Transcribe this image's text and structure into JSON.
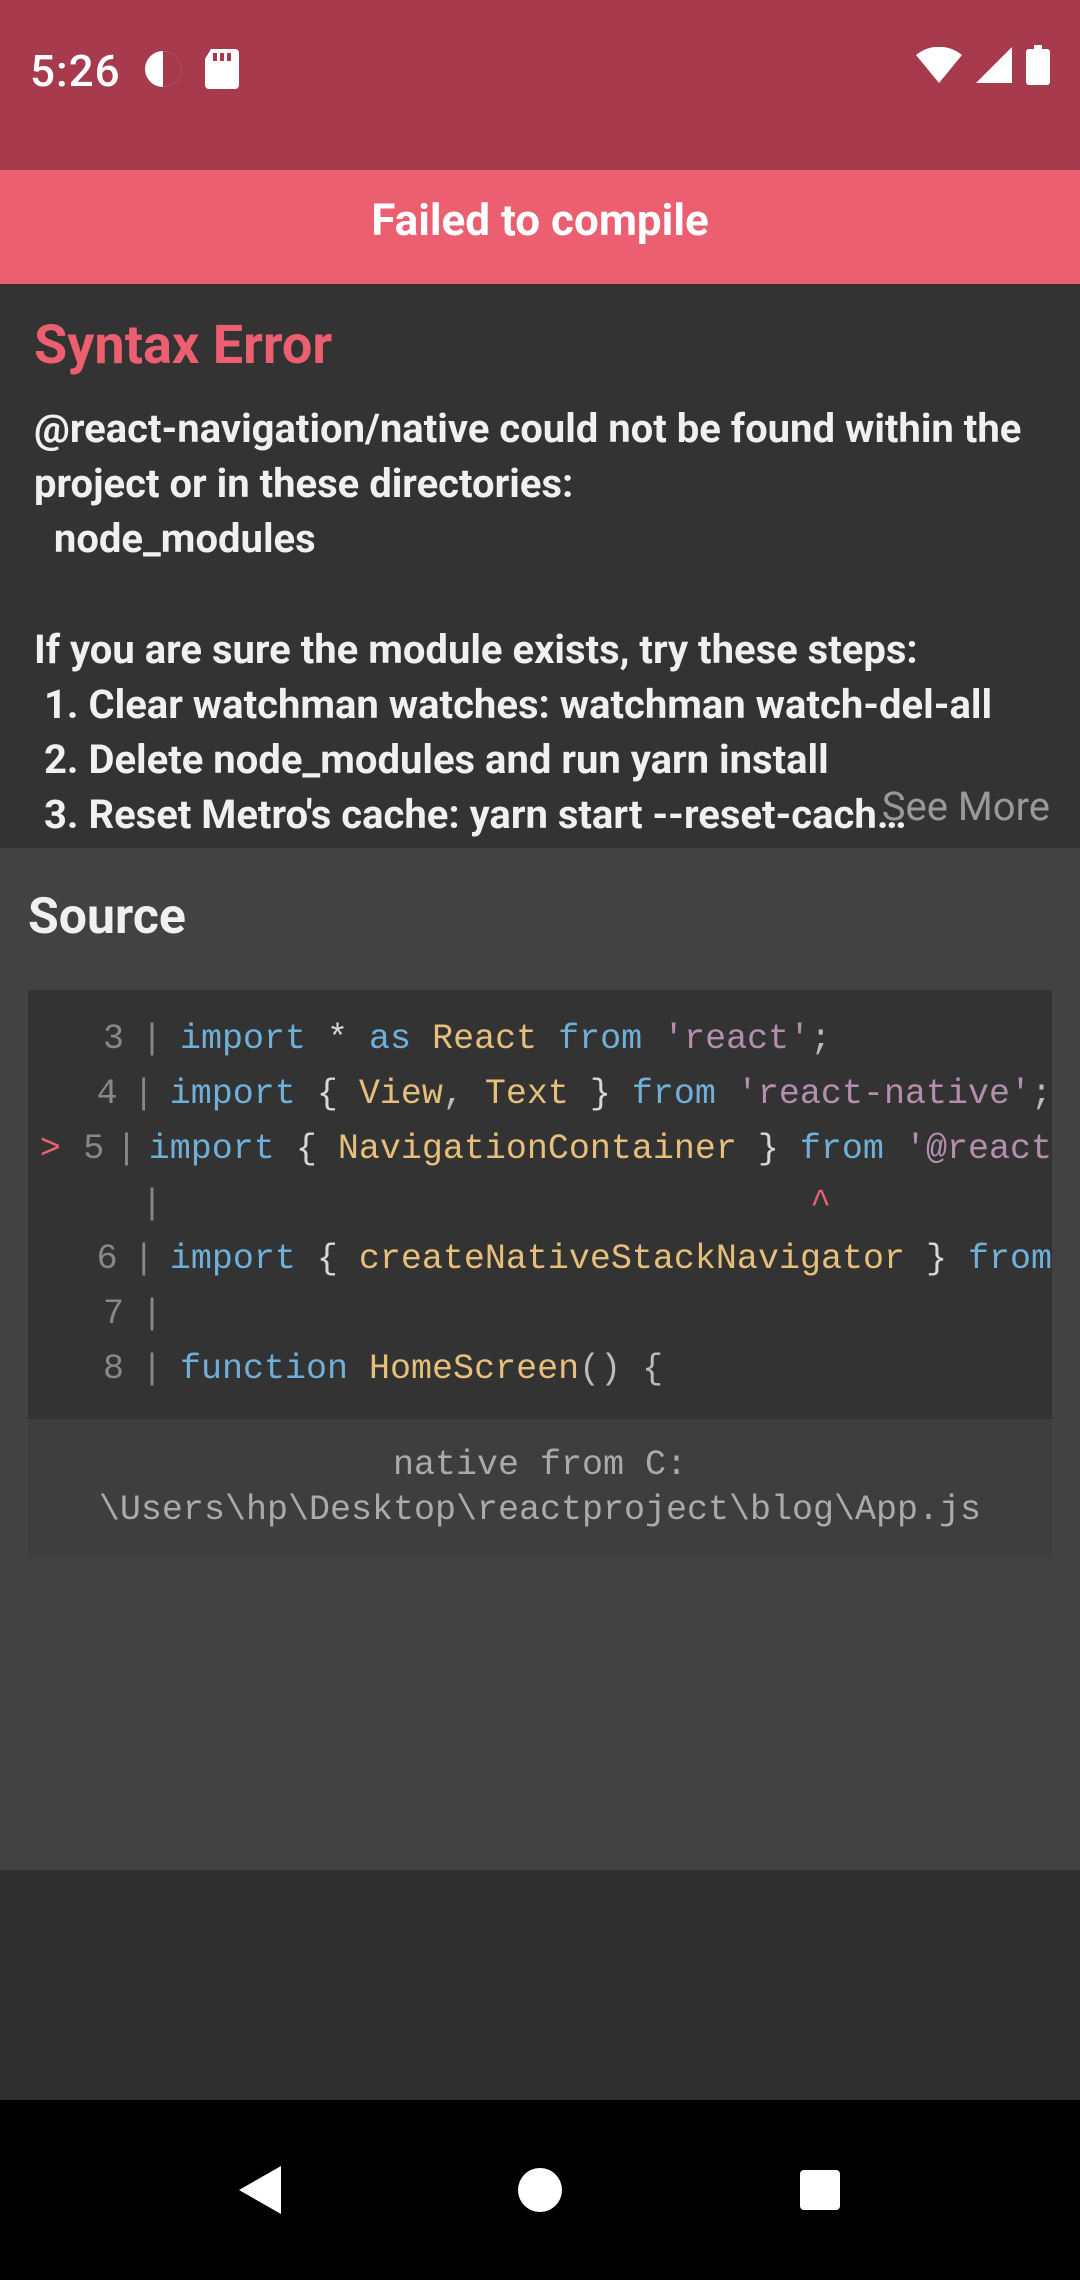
{
  "status": {
    "time": "5:26"
  },
  "banner": {
    "title": "Failed to compile"
  },
  "error": {
    "type": "Syntax Error",
    "message": "@react-navigation/native could not be found within the project or in these directories:\n  node_modules\n\nIf you are sure the module exists, try these steps:\n 1. Clear watchman watches: watchman watch-del-all\n 2. Delete node_modules and run yarn install\n 3. Reset Metro's cache: yarn start --reset-cach…",
    "see_more": "See More"
  },
  "source": {
    "title": "Source",
    "footer": "native from C:\n\\Users\\hp\\Desktop\\reactproject\\blog\\App.js",
    "lines": [
      {
        "n": 3,
        "mark": "",
        "tokens": [
          [
            "kw",
            "import"
          ],
          [
            "op",
            " * "
          ],
          [
            "kw",
            "as"
          ],
          [
            "op",
            " "
          ],
          [
            "id",
            "React"
          ],
          [
            "op",
            " "
          ],
          [
            "kw",
            "from"
          ],
          [
            "op",
            " "
          ],
          [
            "str",
            "'react'"
          ],
          [
            "punc",
            ";"
          ]
        ]
      },
      {
        "n": 4,
        "mark": "",
        "tokens": [
          [
            "kw",
            "import"
          ],
          [
            "op",
            " { "
          ],
          [
            "id",
            "View"
          ],
          [
            "punc",
            ", "
          ],
          [
            "id",
            "Text"
          ],
          [
            "op",
            " } "
          ],
          [
            "kw",
            "from"
          ],
          [
            "op",
            " "
          ],
          [
            "str",
            "'react-native'"
          ],
          [
            "punc",
            ";"
          ]
        ]
      },
      {
        "n": 5,
        "mark": ">",
        "tokens": [
          [
            "kw",
            "import"
          ],
          [
            "op",
            " { "
          ],
          [
            "id",
            "NavigationContainer"
          ],
          [
            "op",
            " } "
          ],
          [
            "kw",
            "from"
          ],
          [
            "op",
            " "
          ],
          [
            "str",
            "'@react"
          ]
        ]
      },
      {
        "n": "",
        "mark": "",
        "tokens": [
          [
            "caret",
            "                              ^"
          ]
        ]
      },
      {
        "n": 6,
        "mark": "",
        "tokens": [
          [
            "kw",
            "import"
          ],
          [
            "op",
            " { "
          ],
          [
            "id",
            "createNativeStackNavigator"
          ],
          [
            "op",
            " } "
          ],
          [
            "kw",
            "from"
          ]
        ]
      },
      {
        "n": 7,
        "mark": "",
        "tokens": []
      },
      {
        "n": 8,
        "mark": "",
        "tokens": [
          [
            "kw",
            "function"
          ],
          [
            "op",
            " "
          ],
          [
            "id",
            "HomeScreen"
          ],
          [
            "punc",
            "() {"
          ]
        ]
      }
    ]
  }
}
